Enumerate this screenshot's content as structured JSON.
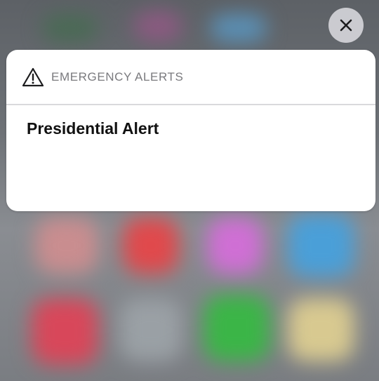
{
  "background": {
    "app_colors": [
      "#4a4f55",
      "#c98d8f",
      "#e0494c",
      "#cf6fd4",
      "#4a9fd8",
      "#d8475a",
      "#9aa0a5",
      "#3bb547",
      "#d8c990",
      "#5a8fb4"
    ]
  },
  "close_button": {
    "icon": "close-icon",
    "color": "#1c1c1e"
  },
  "alert": {
    "app_icon": "warning-icon",
    "app_name": "EMERGENCY ALERTS",
    "title": "Presidential Alert"
  }
}
